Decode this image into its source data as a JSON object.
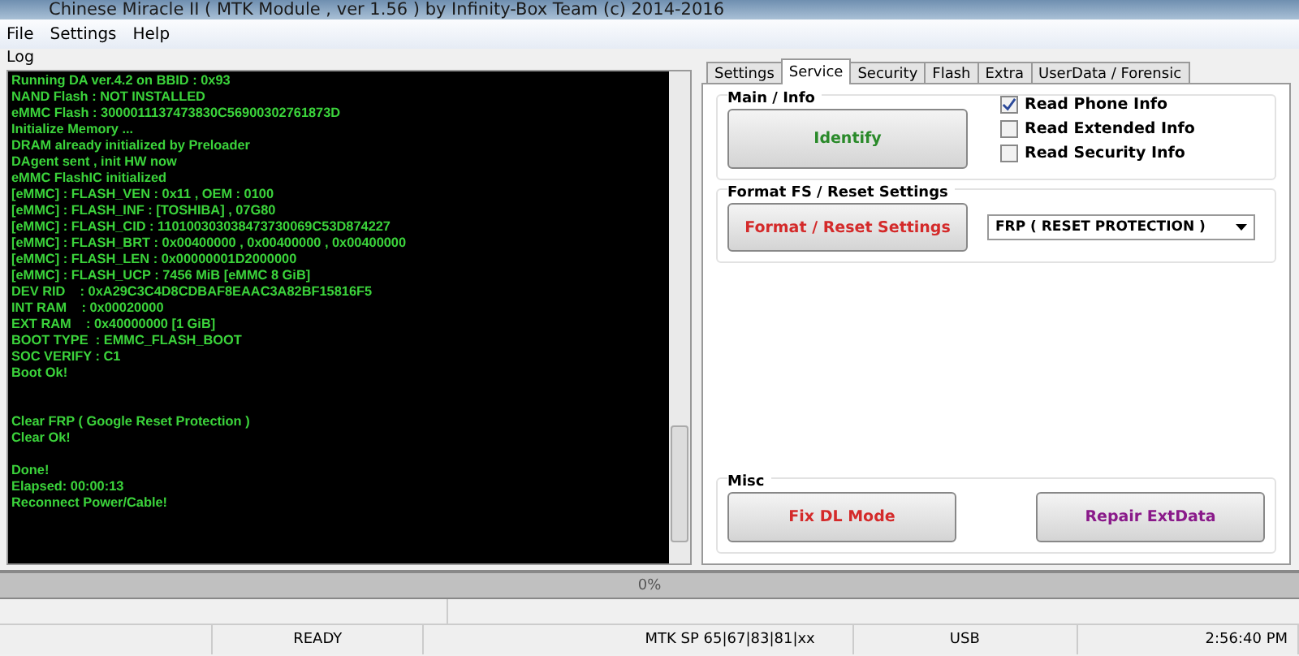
{
  "window": {
    "title": "Chinese Miracle II ( MTK Module , ver 1.56 ) by Infinity-Box Team (c) 2014-2016"
  },
  "menu": [
    "File",
    "Settings",
    "Help"
  ],
  "log": {
    "label": "Log",
    "lines": [
      "Running DA ver.4.2 on BBID : 0x93",
      "NAND Flash : NOT INSTALLED",
      "eMMC Flash : 3000011137473830C56900302761873D",
      "Initialize Memory ...",
      "DRAM already initialized by Preloader",
      "DAgent sent , init HW now",
      "eMMC FlashIC initialized",
      "[eMMC] : FLASH_VEN : 0x11 , OEM : 0100",
      "[eMMC] : FLASH_INF : [TOSHIBA] , 07G80",
      "[eMMC] : FLASH_CID : 110100303038473730069C53D874227",
      "[eMMC] : FLASH_BRT : 0x00400000 , 0x00400000 , 0x00400000",
      "[eMMC] : FLASH_LEN : 0x00000001D2000000",
      "[eMMC] : FLASH_UCP : 7456 MiB [eMMC 8 GiB]",
      "DEV RID    : 0xA29C3C4D8CDBAF8EAAC3A82BF15816F5",
      "INT RAM    : 0x00020000",
      "EXT RAM    : 0x40000000 [1 GiB]",
      "BOOT TYPE  : EMMC_FLASH_BOOT",
      "SOC VERIFY : C1",
      "Boot Ok!",
      {
        "kind": "section",
        "text": "Clear FRP ( Google Reset Protection )"
      },
      "Clear Ok!",
      {
        "kind": "paragraph",
        "text": "Done!"
      },
      "Elapsed: 00:00:13",
      "Reconnect Power/Cable!"
    ]
  },
  "tabs": [
    {
      "label": "Settings",
      "selected": false
    },
    {
      "label": "Service",
      "selected": true
    },
    {
      "label": "Security",
      "selected": false
    },
    {
      "label": "Flash",
      "selected": false
    },
    {
      "label": "Extra",
      "selected": false
    },
    {
      "label": "UserData / Forensic",
      "selected": false
    }
  ],
  "main_info": {
    "title": "Main / Info",
    "button": "Identify",
    "options": [
      {
        "label": "Read Phone Info",
        "checked": true
      },
      {
        "label": "Read Extended Info",
        "checked": false
      },
      {
        "label": "Read Security Info",
        "checked": false
      }
    ]
  },
  "format": {
    "title": "Format FS / Reset Settings",
    "button": "Format / Reset Settings",
    "dropdown": "FRP ( RESET PROTECTION )"
  },
  "misc": {
    "title": "Misc",
    "buttons": [
      {
        "label": "Fix DL Mode",
        "color": "#d42a2a"
      },
      {
        "label": "Repair ExtData",
        "color": "#8a1a8a"
      }
    ]
  },
  "progress": {
    "level": 0,
    "reading": "0%"
  },
  "status_bar": [
    "READY",
    "MTK SP 65|67|83|81|xx",
    "USB",
    "2:56:40 PM"
  ]
}
